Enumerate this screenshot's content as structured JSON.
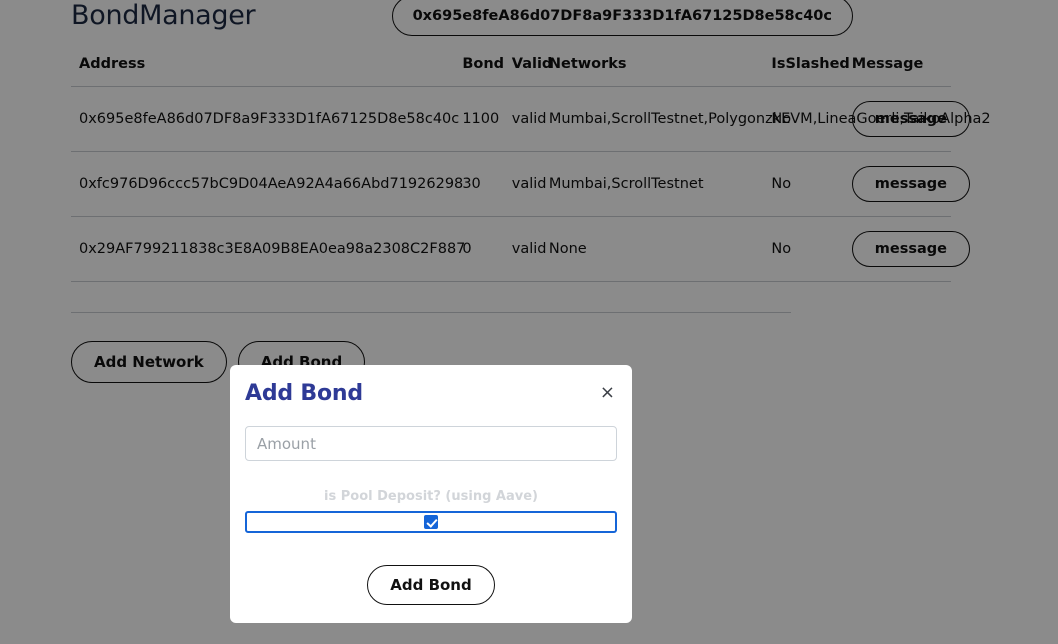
{
  "header": {
    "app_title": "BondManager",
    "account_address": "0x695e8feA86d07DF8a9F333D1fA67125D8e58c40c"
  },
  "table": {
    "columns": [
      "Address",
      "Bond",
      "Valid",
      "Networks",
      "IsSlashed",
      "Message"
    ],
    "rows": [
      {
        "address": "0x695e8feA86d07DF8a9F333D1fA67125D8e58c40c",
        "bond": "1100",
        "valid": "valid",
        "networks": "Mumbai,ScrollTestnet,PolygonzkEVM,LineaGoerli,TaikoAlpha2",
        "is_slashed": "No",
        "message_label": "message"
      },
      {
        "address": "0xfc976D96ccc57bC9D04AeA92A4a66Abd71926298",
        "bond": "30",
        "valid": "valid",
        "networks": "Mumbai,ScrollTestnet",
        "is_slashed": "No",
        "message_label": "message"
      },
      {
        "address": "0x29AF799211838c3E8A09B8EA0ea98a2308C2F887",
        "bond": "0",
        "valid": "valid",
        "networks": "None",
        "is_slashed": "No",
        "message_label": "message"
      }
    ]
  },
  "actions": {
    "add_network_label": "Add Network",
    "add_bond_label": "Add Bond"
  },
  "modal": {
    "title": "Add Bond",
    "close_icon": "close-icon",
    "close_glyph": "×",
    "amount_placeholder": "Amount",
    "amount_value": "",
    "pool_deposit_label": "is Pool Deposit? (using Aave)",
    "pool_deposit_checked": true,
    "submit_label": "Add Bond"
  },
  "colors": {
    "title_blue": "#2e3a96",
    "accent_blue": "#1565d8",
    "app_title": "#1d2a43",
    "border_gray": "#ced4da"
  }
}
